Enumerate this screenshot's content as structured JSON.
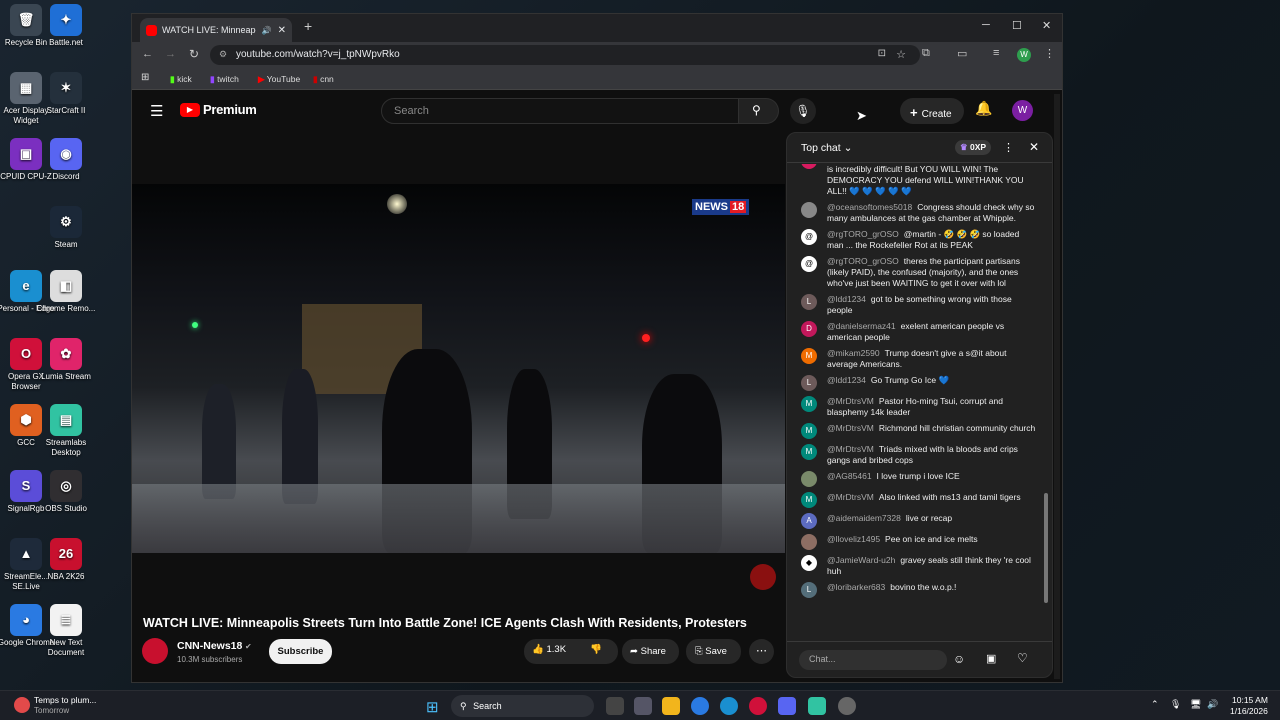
{
  "desktop": {
    "icons": [
      {
        "label": "Recycle Bin",
        "glyph": "🗑",
        "color": "#3a4652"
      },
      {
        "label": "Battle.net",
        "glyph": "✦",
        "color": "#1f6fd6"
      },
      {
        "label": "Acer Display Widget",
        "glyph": "▦",
        "color": "#5a6470"
      },
      {
        "label": "StarCraft II",
        "glyph": "✶",
        "color": "#24303c"
      },
      {
        "label": "CPUID CPU-Z",
        "glyph": "▣",
        "color": "#7b2fc0"
      },
      {
        "label": "Discord",
        "glyph": "◉",
        "color": "#5865f2"
      },
      {
        "label": "Steam",
        "glyph": "⚙",
        "color": "#1b2838"
      },
      {
        "label": "Personal - Edge",
        "glyph": "e",
        "color": "#1a8fd0"
      },
      {
        "label": "Chrome Remo...",
        "glyph": "◧",
        "color": "#dddddd"
      },
      {
        "label": "Opera GX Browser",
        "glyph": "O",
        "color": "#d0103a"
      },
      {
        "label": "Lumia Stream",
        "glyph": "✿",
        "color": "#e0246a"
      },
      {
        "label": "GCC",
        "glyph": "⬢",
        "color": "#e06020"
      },
      {
        "label": "Streamlabs Desktop",
        "glyph": "▤",
        "color": "#31c3a2"
      },
      {
        "label": "SignalRgb",
        "glyph": "S",
        "color": "#5b4dd8"
      },
      {
        "label": "OBS Studio",
        "glyph": "◎",
        "color": "#302e31"
      },
      {
        "label": "StreamEle... SE.Live",
        "glyph": "▲",
        "color": "#1e2a3a"
      },
      {
        "label": "NBA 2K26",
        "glyph": "26",
        "color": "#c8102e"
      },
      {
        "label": "Google Chrome",
        "glyph": "◕",
        "color": "#2a7ae2"
      },
      {
        "label": "New Text Document",
        "glyph": "≣",
        "color": "#f2f2f2"
      }
    ]
  },
  "browser": {
    "tab_title": "WATCH LIVE: Minneapolis S",
    "url": "youtube.com/watch?v=j_tpNWpvRko",
    "bookmarks": [
      "kick",
      "twitch",
      "YouTube",
      "cnn"
    ],
    "profile_initial": "W"
  },
  "youtube": {
    "logo_text": "Premium",
    "search_placeholder": "Search",
    "create_label": "Create",
    "avatar_initial": "W",
    "video_title": "WATCH LIVE: Minneapolis Streets Turn Into Battle Zone! ICE Agents Clash With Residents, Protesters",
    "news_badge": "NEWS",
    "news_badge_num": "18",
    "channel_name": "CNN-News18",
    "subscribers": "10.3M subscribers",
    "subscribe_label": "Subscribe",
    "likes": "1.3K",
    "share_label": "Share",
    "save_label": "Save"
  },
  "chat": {
    "header": "Top chat",
    "xp": "0XP",
    "input_placeholder": "Chat...",
    "messages": [
      {
        "user": "",
        "text": "aggressive, defend yourselves peacefully. I know this is incredibly difficult! But YOU WILL WIN! The DEMOCRACY YOU defend WILL WIN!THANK YOU ALL!! 💙 💙 💙 💙 💙",
        "avatar": "",
        "color": "#d81b60"
      },
      {
        "user": "@oceansoftomes5018",
        "text": "Congress should check why so many ambulances at the gas chamber at Whipple.",
        "avatar": "",
        "color": "#888888"
      },
      {
        "user": "@rgTORO_grOSO",
        "text": "@martin - 🤣 🤣 🤣 so loaded man ... the Rockefeller Rot at its PEAK",
        "avatar": "@",
        "color": "#ffffff"
      },
      {
        "user": "@rgTORO_grOSO",
        "text": "theres the participant partisans (likely PAID), the confused (majority), and the ones who've just been WAITING to get it over with lol",
        "avatar": "@",
        "color": "#ffffff"
      },
      {
        "user": "@ldd1234",
        "text": "got to be something wrong with those people",
        "avatar": "L",
        "color": "#6d5a5a"
      },
      {
        "user": "@danielsermaz41",
        "text": "exelent american people vs american people",
        "avatar": "D",
        "color": "#c2185b"
      },
      {
        "user": "@mikam2590",
        "text": "Trump doesn't give a s@it about average Americans.",
        "avatar": "M",
        "color": "#ef6c00"
      },
      {
        "user": "@ldd1234",
        "text": "Go Trump Go Ice 💙",
        "avatar": "L",
        "color": "#6d5a5a"
      },
      {
        "user": "@MrDtrsVM",
        "text": "Pastor Ho-ming Tsui, corrupt and blasphemy 14k leader",
        "avatar": "M",
        "color": "#00897b"
      },
      {
        "user": "@MrDtrsVM",
        "text": "Richmond hill christian community church",
        "avatar": "M",
        "color": "#00897b"
      },
      {
        "user": "@MrDtrsVM",
        "text": "Triads mixed with la bloods and crips gangs and bribed cops",
        "avatar": "M",
        "color": "#00897b"
      },
      {
        "user": "@AG85461",
        "text": "I love trump i love ICE",
        "avatar": "",
        "color": "#7a8a6a"
      },
      {
        "user": "@MrDtrsVM",
        "text": "Also linked with ms13 and tamil tigers",
        "avatar": "M",
        "color": "#00897b"
      },
      {
        "user": "@aidemaidem7328",
        "text": "live or recap",
        "avatar": "A",
        "color": "#5c6bc0"
      },
      {
        "user": "@lloveliz1495",
        "text": "Pee on ice and ice melts",
        "avatar": "",
        "color": "#8d6e63"
      },
      {
        "user": "@JamieWard-u2h",
        "text": "gravey seals still think they 're cool huh",
        "avatar": "◆",
        "color": "#ffffff"
      },
      {
        "user": "@loribarker683",
        "text": "bovino the w.o.p.!",
        "avatar": "L",
        "color": "#546e7a"
      }
    ]
  },
  "taskbar": {
    "weather": "Temps to plum...",
    "weather_sub": "Tomorrow",
    "search_label": "Search",
    "time": "10:15 AM",
    "date": "1/16/2026"
  }
}
